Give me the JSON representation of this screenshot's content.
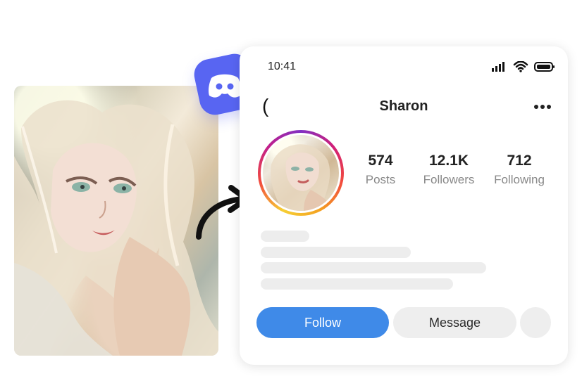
{
  "status_bar": {
    "time": "10:41"
  },
  "profile": {
    "name": "Sharon",
    "stats": [
      {
        "value": "574",
        "label": "Posts"
      },
      {
        "value": "12.1K",
        "label": "Followers"
      },
      {
        "value": "712",
        "label": "Following"
      }
    ]
  },
  "actions": {
    "follow_label": "Follow",
    "message_label": "Message"
  },
  "colors": {
    "follow": "#3f8ae8",
    "discord": "#5865f2",
    "skeleton": "#ededed"
  },
  "icons": [
    "discord-logo-icon",
    "curved-arrow-icon",
    "signal-icon",
    "wifi-icon",
    "battery-icon",
    "back-icon",
    "more-icon"
  ]
}
